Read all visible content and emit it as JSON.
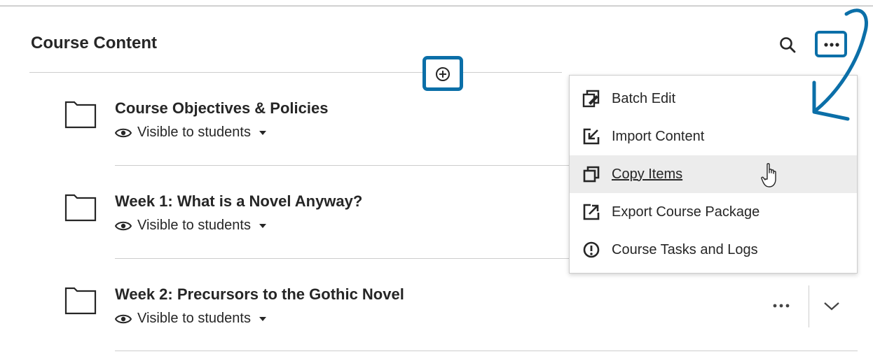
{
  "header": {
    "title": "Course Content",
    "search_icon": "search-icon",
    "more_icon": "more-options-icon",
    "add_icon": "add-content-icon"
  },
  "items": [
    {
      "title": "Course Objectives & Policies",
      "visibility": "Visible to students",
      "icon": "folder-icon"
    },
    {
      "title": "Week 1: What is a Novel Anyway?",
      "visibility": "Visible to students",
      "icon": "folder-icon"
    },
    {
      "title": "Week 2: Precursors to the Gothic Novel",
      "visibility": "Visible to students",
      "icon": "folder-icon"
    }
  ],
  "menu": {
    "items": [
      {
        "label": "Batch Edit",
        "icon": "batch-edit-icon"
      },
      {
        "label": "Import Content",
        "icon": "import-icon"
      },
      {
        "label": "Copy Items",
        "icon": "copy-icon",
        "highlighted": true
      },
      {
        "label": "Export Course Package",
        "icon": "export-icon"
      },
      {
        "label": "Course Tasks and Logs",
        "icon": "alert-icon"
      }
    ]
  },
  "colors": {
    "highlight_border": "#0b6fa8",
    "text": "#262626",
    "menu_hover": "#ececec"
  }
}
